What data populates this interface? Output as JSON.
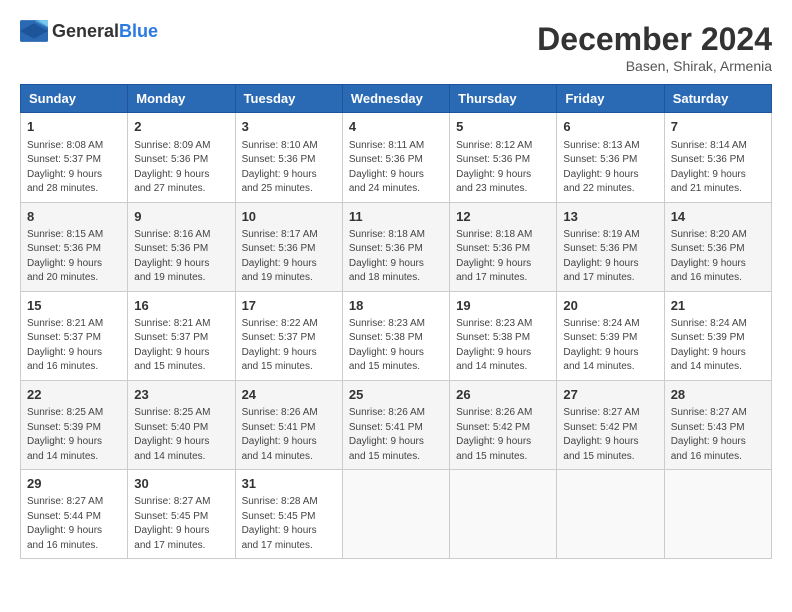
{
  "logo": {
    "general": "General",
    "blue": "Blue"
  },
  "header": {
    "month": "December 2024",
    "location": "Basen, Shirak, Armenia"
  },
  "weekdays": [
    "Sunday",
    "Monday",
    "Tuesday",
    "Wednesday",
    "Thursday",
    "Friday",
    "Saturday"
  ],
  "weeks": [
    [
      {
        "day": "1",
        "sunrise": "Sunrise: 8:08 AM",
        "sunset": "Sunset: 5:37 PM",
        "daylight": "Daylight: 9 hours and 28 minutes."
      },
      {
        "day": "2",
        "sunrise": "Sunrise: 8:09 AM",
        "sunset": "Sunset: 5:36 PM",
        "daylight": "Daylight: 9 hours and 27 minutes."
      },
      {
        "day": "3",
        "sunrise": "Sunrise: 8:10 AM",
        "sunset": "Sunset: 5:36 PM",
        "daylight": "Daylight: 9 hours and 25 minutes."
      },
      {
        "day": "4",
        "sunrise": "Sunrise: 8:11 AM",
        "sunset": "Sunset: 5:36 PM",
        "daylight": "Daylight: 9 hours and 24 minutes."
      },
      {
        "day": "5",
        "sunrise": "Sunrise: 8:12 AM",
        "sunset": "Sunset: 5:36 PM",
        "daylight": "Daylight: 9 hours and 23 minutes."
      },
      {
        "day": "6",
        "sunrise": "Sunrise: 8:13 AM",
        "sunset": "Sunset: 5:36 PM",
        "daylight": "Daylight: 9 hours and 22 minutes."
      },
      {
        "day": "7",
        "sunrise": "Sunrise: 8:14 AM",
        "sunset": "Sunset: 5:36 PM",
        "daylight": "Daylight: 9 hours and 21 minutes."
      }
    ],
    [
      {
        "day": "8",
        "sunrise": "Sunrise: 8:15 AM",
        "sunset": "Sunset: 5:36 PM",
        "daylight": "Daylight: 9 hours and 20 minutes."
      },
      {
        "day": "9",
        "sunrise": "Sunrise: 8:16 AM",
        "sunset": "Sunset: 5:36 PM",
        "daylight": "Daylight: 9 hours and 19 minutes."
      },
      {
        "day": "10",
        "sunrise": "Sunrise: 8:17 AM",
        "sunset": "Sunset: 5:36 PM",
        "daylight": "Daylight: 9 hours and 19 minutes."
      },
      {
        "day": "11",
        "sunrise": "Sunrise: 8:18 AM",
        "sunset": "Sunset: 5:36 PM",
        "daylight": "Daylight: 9 hours and 18 minutes."
      },
      {
        "day": "12",
        "sunrise": "Sunrise: 8:18 AM",
        "sunset": "Sunset: 5:36 PM",
        "daylight": "Daylight: 9 hours and 17 minutes."
      },
      {
        "day": "13",
        "sunrise": "Sunrise: 8:19 AM",
        "sunset": "Sunset: 5:36 PM",
        "daylight": "Daylight: 9 hours and 17 minutes."
      },
      {
        "day": "14",
        "sunrise": "Sunrise: 8:20 AM",
        "sunset": "Sunset: 5:36 PM",
        "daylight": "Daylight: 9 hours and 16 minutes."
      }
    ],
    [
      {
        "day": "15",
        "sunrise": "Sunrise: 8:21 AM",
        "sunset": "Sunset: 5:37 PM",
        "daylight": "Daylight: 9 hours and 16 minutes."
      },
      {
        "day": "16",
        "sunrise": "Sunrise: 8:21 AM",
        "sunset": "Sunset: 5:37 PM",
        "daylight": "Daylight: 9 hours and 15 minutes."
      },
      {
        "day": "17",
        "sunrise": "Sunrise: 8:22 AM",
        "sunset": "Sunset: 5:37 PM",
        "daylight": "Daylight: 9 hours and 15 minutes."
      },
      {
        "day": "18",
        "sunrise": "Sunrise: 8:23 AM",
        "sunset": "Sunset: 5:38 PM",
        "daylight": "Daylight: 9 hours and 15 minutes."
      },
      {
        "day": "19",
        "sunrise": "Sunrise: 8:23 AM",
        "sunset": "Sunset: 5:38 PM",
        "daylight": "Daylight: 9 hours and 14 minutes."
      },
      {
        "day": "20",
        "sunrise": "Sunrise: 8:24 AM",
        "sunset": "Sunset: 5:39 PM",
        "daylight": "Daylight: 9 hours and 14 minutes."
      },
      {
        "day": "21",
        "sunrise": "Sunrise: 8:24 AM",
        "sunset": "Sunset: 5:39 PM",
        "daylight": "Daylight: 9 hours and 14 minutes."
      }
    ],
    [
      {
        "day": "22",
        "sunrise": "Sunrise: 8:25 AM",
        "sunset": "Sunset: 5:39 PM",
        "daylight": "Daylight: 9 hours and 14 minutes."
      },
      {
        "day": "23",
        "sunrise": "Sunrise: 8:25 AM",
        "sunset": "Sunset: 5:40 PM",
        "daylight": "Daylight: 9 hours and 14 minutes."
      },
      {
        "day": "24",
        "sunrise": "Sunrise: 8:26 AM",
        "sunset": "Sunset: 5:41 PM",
        "daylight": "Daylight: 9 hours and 14 minutes."
      },
      {
        "day": "25",
        "sunrise": "Sunrise: 8:26 AM",
        "sunset": "Sunset: 5:41 PM",
        "daylight": "Daylight: 9 hours and 15 minutes."
      },
      {
        "day": "26",
        "sunrise": "Sunrise: 8:26 AM",
        "sunset": "Sunset: 5:42 PM",
        "daylight": "Daylight: 9 hours and 15 minutes."
      },
      {
        "day": "27",
        "sunrise": "Sunrise: 8:27 AM",
        "sunset": "Sunset: 5:42 PM",
        "daylight": "Daylight: 9 hours and 15 minutes."
      },
      {
        "day": "28",
        "sunrise": "Sunrise: 8:27 AM",
        "sunset": "Sunset: 5:43 PM",
        "daylight": "Daylight: 9 hours and 16 minutes."
      }
    ],
    [
      {
        "day": "29",
        "sunrise": "Sunrise: 8:27 AM",
        "sunset": "Sunset: 5:44 PM",
        "daylight": "Daylight: 9 hours and 16 minutes."
      },
      {
        "day": "30",
        "sunrise": "Sunrise: 8:27 AM",
        "sunset": "Sunset: 5:45 PM",
        "daylight": "Daylight: 9 hours and 17 minutes."
      },
      {
        "day": "31",
        "sunrise": "Sunrise: 8:28 AM",
        "sunset": "Sunset: 5:45 PM",
        "daylight": "Daylight: 9 hours and 17 minutes."
      },
      null,
      null,
      null,
      null
    ]
  ]
}
